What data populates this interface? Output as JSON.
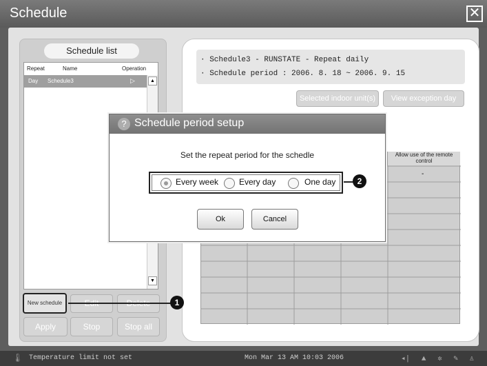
{
  "window": {
    "title": "Schedule",
    "close_symbol": "✕"
  },
  "schedule_list": {
    "title": "Schedule list",
    "columns": [
      "Repeat",
      "Name",
      "Operation"
    ],
    "rows": [
      {
        "repeat": "Day",
        "name": "Schedule3",
        "operation": "▷"
      }
    ],
    "buttons": {
      "new_schedule": "New schedule",
      "edit": "Edit",
      "delete": "Delete",
      "apply": "Apply",
      "stop": "Stop",
      "stop_all": "Stop all"
    }
  },
  "right_panel": {
    "info_lines": [
      "· Schedule3 - RUNSTATE - Repeat daily",
      "· Schedule period : 2006. 8. 18 ~ 2006. 9. 15"
    ],
    "buttons": {
      "selected_units": "Selected indoor unit(s)",
      "view_exception": "View exception day"
    },
    "grid_col_header": "Allow use of the remote control",
    "grid_dash": "-"
  },
  "dialog": {
    "title": "Schedule period setup",
    "message": "Set the repeat period for the schedle",
    "options": [
      {
        "label": "Every week",
        "checked": true
      },
      {
        "label": "Every day",
        "checked": false
      },
      {
        "label": "One day",
        "checked": false
      }
    ],
    "ok": "Ok",
    "cancel": "Cancel"
  },
  "callouts": [
    "1",
    "2"
  ],
  "status_bar": {
    "message": "Temperature limit not set",
    "datetime": "Mon Mar 13 AM 10:03 2006"
  }
}
